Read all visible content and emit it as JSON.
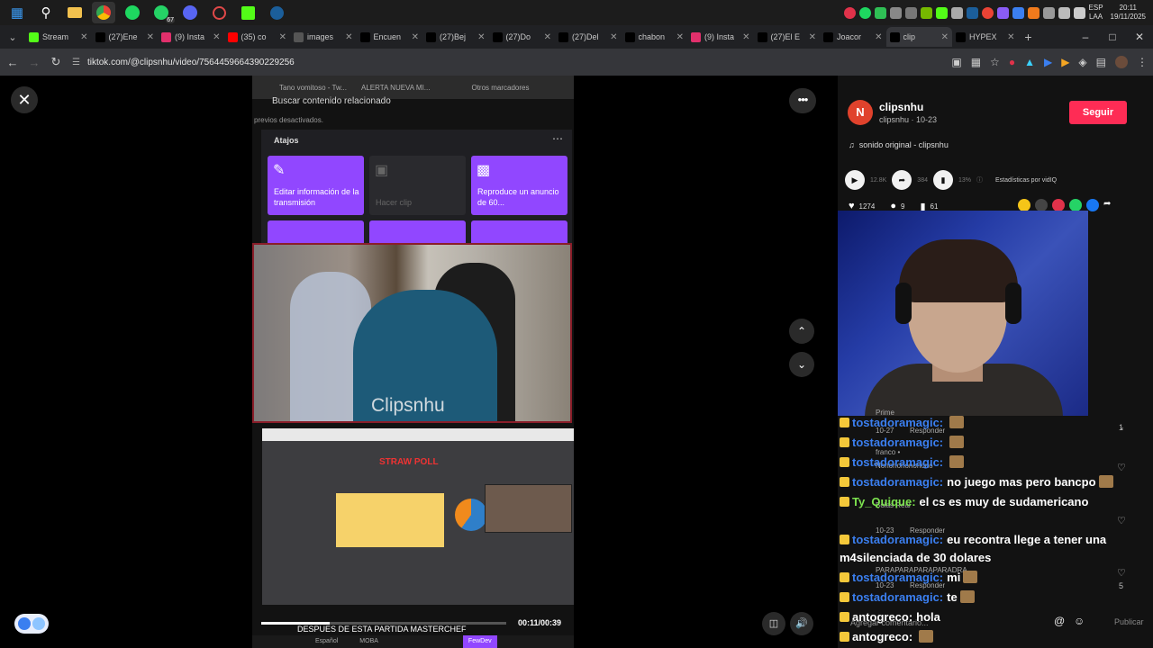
{
  "taskbar": {
    "apps": [
      "windows-start",
      "search",
      "file-explorer",
      "chrome",
      "spotify",
      "whatsapp",
      "discord",
      "other-app",
      "kick",
      "steam"
    ],
    "whatsapp_badge": "67",
    "lang_top": "ESP",
    "lang_bottom": "LAA",
    "time": "20:11",
    "date": "19/11/2025"
  },
  "tabs": [
    {
      "label": "Stream",
      "icon": "kick-icon",
      "color": "#53fc18"
    },
    {
      "label": "(27)Ene",
      "icon": "tiktok-icon",
      "color": "#000000"
    },
    {
      "label": "(9) Insta",
      "icon": "instagram-icon",
      "color": "#e1306c"
    },
    {
      "label": "(35) co",
      "icon": "youtube-icon",
      "color": "#ff0000"
    },
    {
      "label": "images",
      "icon": "globe-icon",
      "color": "#555555"
    },
    {
      "label": "Encuen",
      "icon": "tiktok-icon",
      "color": "#000000"
    },
    {
      "label": "(27)Bej",
      "icon": "tiktok-icon",
      "color": "#000000"
    },
    {
      "label": "(27)Do",
      "icon": "tiktok-icon",
      "color": "#000000"
    },
    {
      "label": "(27)Del",
      "icon": "tiktok-icon",
      "color": "#000000"
    },
    {
      "label": "chabon",
      "icon": "tiktok-icon",
      "color": "#000000"
    },
    {
      "label": "(9) Insta",
      "icon": "instagram-icon",
      "color": "#e1306c"
    },
    {
      "label": "(27)El E",
      "icon": "tiktok-icon",
      "color": "#000000"
    },
    {
      "label": "Joacor",
      "icon": "x-icon",
      "color": "#000000"
    },
    {
      "label": "clip",
      "icon": "tiktok-icon",
      "color": "#000000",
      "active": true
    },
    {
      "label": "HYPEX",
      "icon": "x-icon",
      "color": "#000000"
    }
  ],
  "address": {
    "url": "tiktok.com/@clipsnhu/video/7564459664390229256"
  },
  "video": {
    "bookmarks": [
      "Tano vomitoso - Tw...",
      "ALERTA NUEVA MI...",
      "Otros marcadores"
    ],
    "search_text": "Buscar contenido relacionado",
    "desact_text": "previos desactivados.",
    "atajos_label": "Atajos",
    "cards": [
      "Editar información de la transmisión",
      "Hacer clip",
      "Reproduce un anuncio de 60..."
    ],
    "watermark": "Clipsnhu",
    "poll_logo": "STRAW POLL",
    "time": "00:11/00:39",
    "progress": 0.28,
    "caption": "DESPUES DE ESTA PARTIDA MASTERCHEF",
    "tags": [
      "Español",
      "MOBA",
      "FewDev"
    ]
  },
  "profile": {
    "avatar_letter": "N",
    "username": "clipsnhu",
    "meta": "clipsnhu · 10-23",
    "follow_label": "Seguir",
    "sound": "sonido original - clipsnhu",
    "views": "12.8K",
    "shares_stat": "384",
    "ratio": "13%",
    "vidiq_label": "Estadísticas por vidIQ",
    "likes": "1274",
    "comments": "9",
    "saves": "61"
  },
  "chat": [
    {
      "user": "tostadoramagic:",
      "msg": "",
      "color": "blue"
    },
    {
      "user": "tostadoramagic:",
      "msg": "",
      "color": "blue"
    },
    {
      "user": "tostadoramagic:",
      "msg": "",
      "color": "blue"
    },
    {
      "user": "tostadoramagic:",
      "msg": "no juego mas pero bancpo",
      "color": "blue"
    },
    {
      "user": "Ty_Quique:",
      "msg": "el cs es muy de sudamericano",
      "color": "green"
    },
    {
      "user": "tostadoramagic:",
      "msg": "eu recontra llege a tener una",
      "color": "blue"
    },
    {
      "user": "",
      "msg": "m4silenciada de 30 dolares",
      "color": "white"
    },
    {
      "user": "tostadoramagic:",
      "msg": "mi",
      "color": "blue"
    },
    {
      "user": "tostadoramagic:",
      "msg": "te",
      "color": "blue"
    },
    {
      "user": "antogreco:",
      "msg": "hola",
      "color": "white"
    },
    {
      "user": "antogreco:",
      "msg": "",
      "color": "white"
    }
  ],
  "comments_meta": {
    "prime": "Prime",
    "c1_date": "10-27",
    "c1_reply": "Responder",
    "c1_count": "1",
    "franco": "franco •",
    "nono": "Nonononononono",
    "bolas": "Bolas Real",
    "c3_date": "10-23",
    "c3_reply": "Responder",
    "para": "PARAPARAPARAPARADRA",
    "c4_date": "10-23",
    "c4_reply": "Responder",
    "c4_count": "5"
  },
  "comment_bar": {
    "placeholder": "Agregar comentario...",
    "post_label": "Publicar"
  }
}
